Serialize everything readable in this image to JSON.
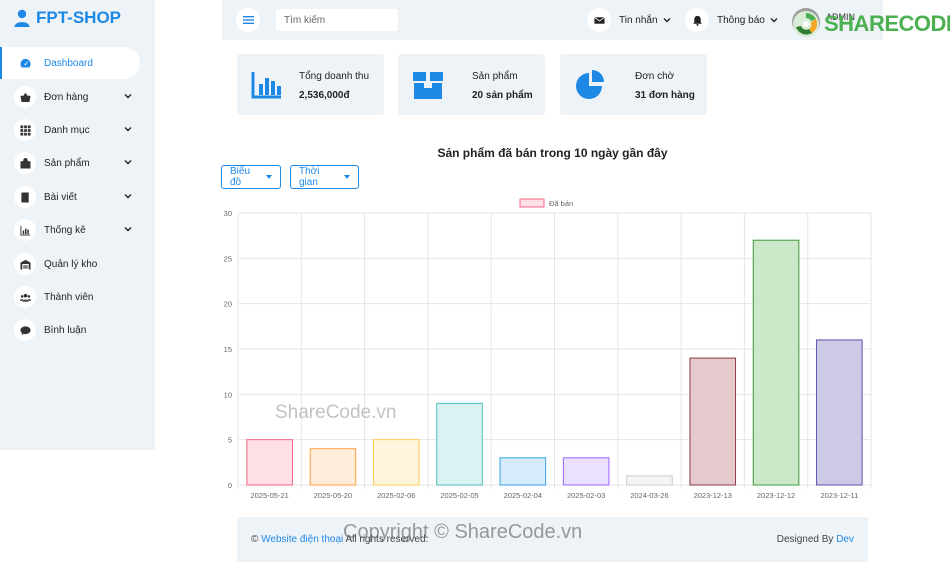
{
  "brand": {
    "name": "FPT-SHOP"
  },
  "sidebar": {
    "items": [
      {
        "label": "Dashboard",
        "icon": "dashboard-icon",
        "active": true,
        "has_submenu": false
      },
      {
        "label": "Đơn hàng",
        "icon": "basket-icon",
        "active": false,
        "has_submenu": true
      },
      {
        "label": "Danh mục",
        "icon": "grid-icon",
        "active": false,
        "has_submenu": true
      },
      {
        "label": "Sản phẩm",
        "icon": "bag-icon",
        "active": false,
        "has_submenu": true
      },
      {
        "label": "Bài viết",
        "icon": "book-icon",
        "active": false,
        "has_submenu": true
      },
      {
        "label": "Thống kê",
        "icon": "bar-chart-icon",
        "active": false,
        "has_submenu": true
      },
      {
        "label": "Quản lý kho",
        "icon": "warehouse-icon",
        "active": false,
        "has_submenu": false
      },
      {
        "label": "Thành viên",
        "icon": "users-icon",
        "active": false,
        "has_submenu": false
      },
      {
        "label": "Bình luận",
        "icon": "comment-icon",
        "active": false,
        "has_submenu": false
      }
    ]
  },
  "topbar": {
    "search_placeholder": "Tìm kiếm",
    "messages_label": "Tin nhắn",
    "notifications_label": "Thông báo",
    "user_label": "ADMIN"
  },
  "stats": [
    {
      "title": "Tổng doanh thu",
      "value": "2,536,000đ",
      "icon": "revenue-chart-icon"
    },
    {
      "title": "Sản phẩm",
      "value": "20 sản phẩm",
      "icon": "box-icon"
    },
    {
      "title": "Đơn chờ",
      "value": "31 đơn hàng",
      "icon": "pie-icon"
    }
  ],
  "chart_controls": {
    "chart_dropdown": "Biểu đồ",
    "time_dropdown": "Thời gian"
  },
  "chart_data": {
    "type": "bar",
    "title": "Sản phẩm đã bán trong 10 ngày gần đây",
    "categories": [
      "2025-05-21",
      "2025-05-20",
      "2025-02-06",
      "2025-02-05",
      "2025-02-04",
      "2025-02-03",
      "2024-03-26",
      "2023-12-13",
      "2023-12-12",
      "2023-12-11"
    ],
    "series": [
      {
        "name": "Đã bán",
        "values": [
          5,
          4,
          5,
          9,
          3,
          3,
          1,
          14,
          27,
          16
        ]
      }
    ],
    "ylim": [
      0,
      30
    ],
    "yticks": [
      0,
      5,
      10,
      15,
      20,
      25,
      30
    ],
    "legend_position": "top",
    "grid": true,
    "fill_colors": [
      "#ffe0e6",
      "#ffecd9",
      "#fff5dd",
      "#dbf2f2",
      "#d7ecfb",
      "#ebe0ff",
      "#f4f5f5",
      "#e6c9cc",
      "#cce8c9",
      "#cdcae8"
    ],
    "border_colors": [
      "#ff6384",
      "#ff9f40",
      "#ffcd56",
      "#4bc0c0",
      "#36a2eb",
      "#9966ff",
      "#c9cbcf",
      "#8a3b44",
      "#3f9a3a",
      "#5a53a8"
    ],
    "legend_fill": "#ffe0e6",
    "legend_border": "#ff6384"
  },
  "footer": {
    "copyright_symbol": "©",
    "site_link": "Website điện thoại",
    "rights": "All rights reserved.",
    "designed_by": "Designed By",
    "designer": "Dev"
  },
  "watermarks": {
    "logo_text": "SHARECODE.vn",
    "mid_text": "ShareCode.vn",
    "bottom_text": "Copyright © ShareCode.vn"
  },
  "colors": {
    "accent": "#1e88e5",
    "panel": "#eef3f8"
  }
}
